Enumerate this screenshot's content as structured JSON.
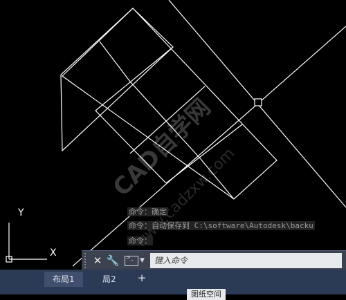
{
  "watermark": {
    "line1": "CAD自学网",
    "line2": "www.cadzxw.com"
  },
  "command_history": [
    "命令：确定",
    "命令：自动保存到 C:\\software\\Autodesk\\backu",
    "命令："
  ],
  "command_line": {
    "close_label": "✕",
    "settings_label": "🔧",
    "placeholder": "键入命令"
  },
  "layout_tabs": [
    {
      "label": "布局1",
      "active": true
    },
    {
      "label": "局2",
      "active": false
    }
  ],
  "add_tab_label": "+",
  "status": {
    "model_label": "图纸空间"
  },
  "ucs": {
    "x_label": "X",
    "y_label": "Y"
  },
  "colors": {
    "canvas": "#000000",
    "lines": "#ffffff",
    "tabbar": "#2b3a55",
    "cmdbar": "#3c4250"
  }
}
